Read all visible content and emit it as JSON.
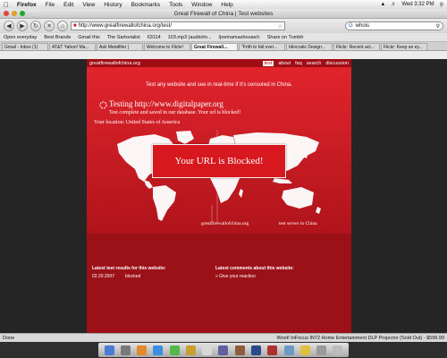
{
  "menubar": {
    "items": [
      "Firefox",
      "File",
      "Edit",
      "View",
      "History",
      "Bookmarks",
      "Tools",
      "Window",
      "Help"
    ],
    "clock": "Wed 3:32 PM"
  },
  "window": {
    "title": "Great Firewall of China | Test websites",
    "url": "http://www.greatfirewallofchina.org/test/",
    "search_value": "whois"
  },
  "bookmarks": [
    "Open everyday",
    "Best Brands",
    "Gmail this",
    "The Sartorialist",
    "63114",
    "103.mp3 (audio/m...",
    "/joemamashouse/c",
    "Share on Tumblr"
  ],
  "tabs": [
    "Gmail - Inbox (1)",
    "AT&T Yahoo! Ma...",
    "Ask Metafilter |",
    "Welcome to Flickr!",
    "Great Firewall...",
    "\"Frith to fall over...",
    "Idiocratic Design...",
    "Flickr: Recent act...",
    "Flickr: Keep an ey..."
  ],
  "site": {
    "logo": "greatfirewallofchina.org",
    "nav": [
      "test",
      "about",
      "faq",
      "search",
      "discussion"
    ],
    "tagline": "Test any website and see in real-time if it's censored in China.",
    "testing": "Testing http://www.digitalpaper.org",
    "result": "Test complete and saved in our database. Your url is blocked!",
    "location": "Your location: United States of America",
    "blocked": "Your URL is Blocked!",
    "server1": "greatfirewallofchina.org",
    "server2": "test server in China",
    "latest_results_title": "Latest test results for this website:",
    "latest_result_date": "02.20.2007",
    "latest_result_status": "blocked",
    "comments_title": "Latest comments about this website:",
    "comments_link": "» Give your reaction"
  },
  "status": {
    "left": "Done",
    "right": "Woot! InFocus IN72 Home Entertainment DLP Projector (Sold Out) - $599.99"
  },
  "colors": {
    "site_red": "#c21a20",
    "blocked_red": "#d8181f"
  }
}
